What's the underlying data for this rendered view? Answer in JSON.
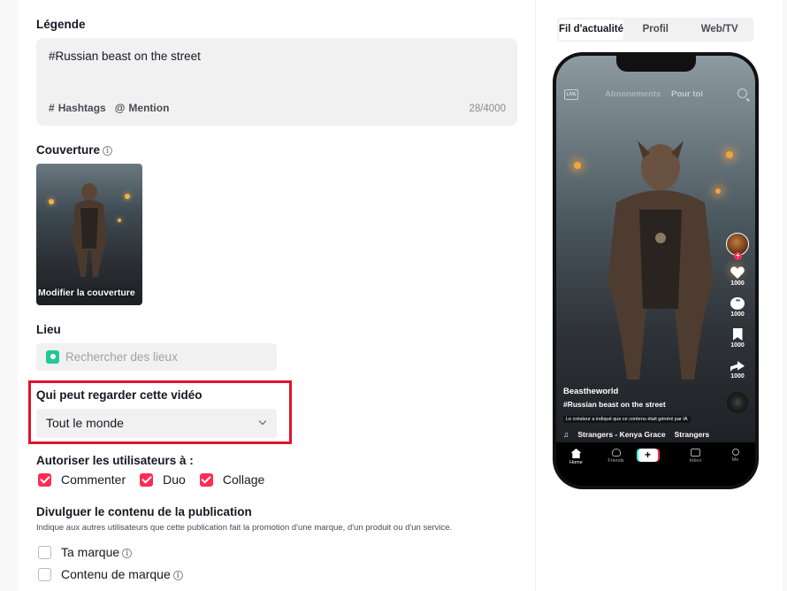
{
  "caption": {
    "title": "Légende",
    "text": "#Russian beast on the street",
    "hashtags_label": "Hashtags",
    "mention_label": "Mention",
    "count": "28/4000"
  },
  "cover": {
    "title": "Couverture",
    "edit_label": "Modifier la couverture"
  },
  "location": {
    "title": "Lieu",
    "placeholder": "Rechercher des lieux"
  },
  "privacy": {
    "title": "Qui peut regarder cette vidéo",
    "value": "Tout le monde",
    "highlight_color": "#e0142c"
  },
  "allow": {
    "title": "Autoriser les utilisateurs à :",
    "options": [
      {
        "label": "Commenter",
        "checked": true
      },
      {
        "label": "Duo",
        "checked": true
      },
      {
        "label": "Collage",
        "checked": true
      }
    ]
  },
  "disclose": {
    "title": "Divulguer le contenu de la publication",
    "description": "Indique aux autres utilisateurs que cette publication fait la promotion d'une marque, d'un produit ou d'un service.",
    "options": [
      {
        "label": "Ta marque",
        "checked": false
      },
      {
        "label": "Contenu de marque",
        "checked": false
      }
    ]
  },
  "preview": {
    "tabs": [
      "Fil d'actualité",
      "Profil",
      "Web/TV"
    ],
    "active_tab": "Fil d'actualité",
    "top_nav": {
      "live": "LIVE",
      "following": "Abonnements",
      "for_you": "Pour toi"
    },
    "username": "Beastheworld",
    "caption": "#Russian beast on the street",
    "ai_notice": "Le créateur a indiqué que ce contenu était généré par IA",
    "music": [
      "Strangers - Kenya Grace",
      "Strangers"
    ],
    "counts": {
      "likes": "1000",
      "comments": "1000",
      "saves": "1000",
      "shares": "1000"
    },
    "bottom_nav": [
      "Home",
      "Friends",
      "Inbox",
      "Me"
    ],
    "accent": "#fe2c55"
  }
}
